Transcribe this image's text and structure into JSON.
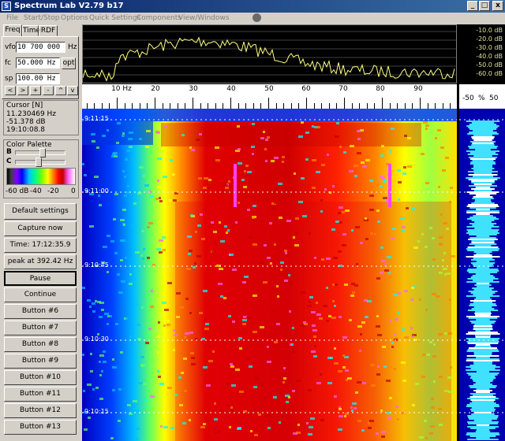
{
  "window": {
    "title": "Spectrum Lab V2.79 b17",
    "minimize_glyph": "_",
    "maximize_glyph": "□",
    "close_glyph": "x"
  },
  "menu": [
    "File",
    "Start/Stop",
    "Options",
    "Quick Settings",
    "Components",
    "View/Windows"
  ],
  "tabs": [
    "Freq",
    "Time",
    "RDF"
  ],
  "freq": {
    "vfo_label": "vfo",
    "vfo_value": "10 700 000",
    "vfo_unit": "Hz",
    "fc_label": "fc",
    "fc_value": "50.000 Hz",
    "fc_button": "opt",
    "sp_label": "sp",
    "sp_value": "100.00 Hz"
  },
  "scroll_buttons": [
    "<",
    ">",
    "+",
    "-",
    "^",
    "v"
  ],
  "cursor": {
    "title": "Cursor [N]",
    "freq": "11.230469 Hz",
    "level": "-51.378 dB",
    "time": "19:10:08.8"
  },
  "palette": {
    "title": "Color Palette",
    "b_label": "B",
    "c_label": "C",
    "b_level": 0.53,
    "c_level": 0.45,
    "scale_labels": [
      "-60 dB",
      "-40",
      "-20",
      "0"
    ]
  },
  "buttons": [
    "Default settings",
    "Capture now",
    "Time:  17:12:35.9",
    "peak at 392.42 Hz",
    "Pause",
    "Continue",
    "Button #6",
    "Button #7",
    "Button #8",
    "Button #9",
    "Button #10",
    "Button #11",
    "Button #12",
    "Button #13"
  ],
  "db_labels": [
    "-10.0 dB",
    "-20.0 dB",
    "-30.0 dB",
    "-40.0 dB",
    "-50.0 dB",
    "-60.0 dB"
  ],
  "freq_axis": [
    "10",
    "20",
    "30",
    "40",
    "50",
    "60",
    "70",
    "80",
    "90"
  ],
  "freq_axis_unit": "Hz",
  "right_axis": [
    "-50",
    "%",
    "50"
  ],
  "time_labels": [
    "9:11:15",
    "9:11:00",
    "9:10:45",
    "9:10:30",
    "9:10:15"
  ],
  "colors": {
    "titlebar": "#0a246a",
    "spectrum_trace": "#ffff80",
    "waterfall_bg": "#0000c0"
  }
}
